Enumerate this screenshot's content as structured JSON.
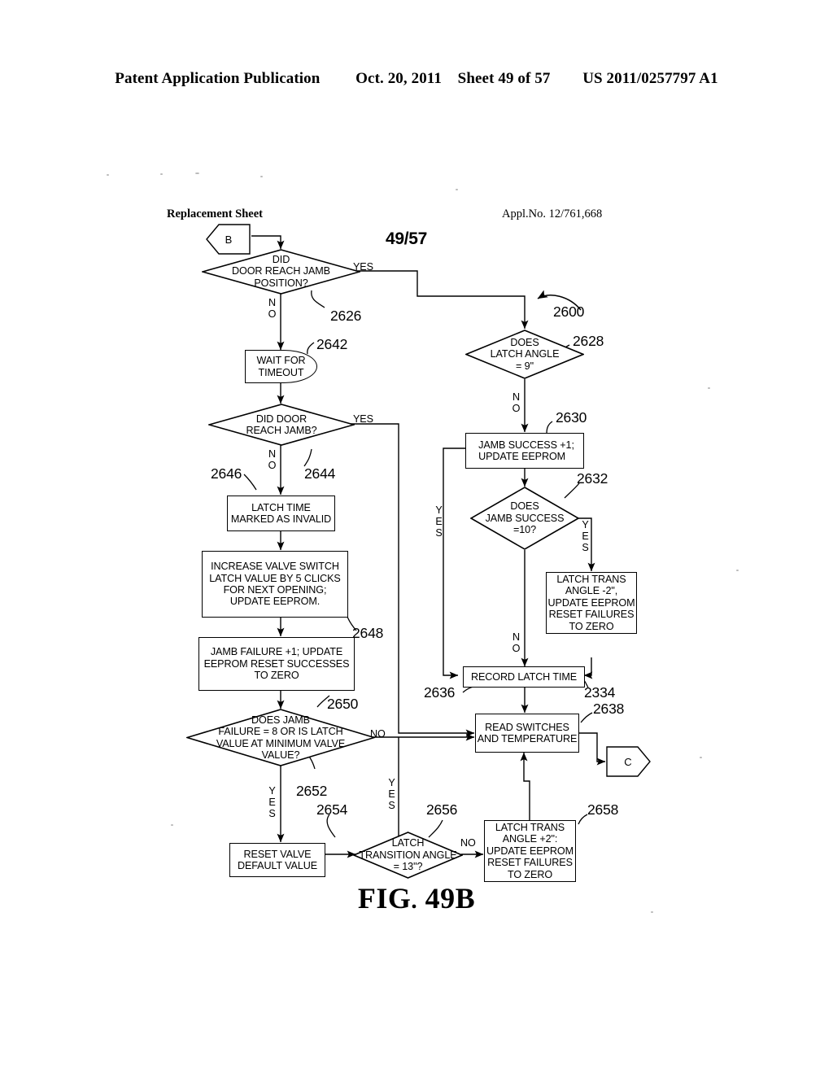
{
  "header": {
    "publication": "Patent Application Publication",
    "date": "Oct. 20, 2011",
    "sheet": "Sheet 49 of 57",
    "doc_number": "US 2011/0257797 A1"
  },
  "sheet_info": {
    "replacement_sheet": "Replacement Sheet",
    "appl_no": "Appl.No. 12/761,668",
    "sheet_fraction": "49/57"
  },
  "figure": {
    "caption_prefix": "FIG",
    "caption_dot": ".",
    "caption_number": "49B",
    "overall_ref": "2600"
  },
  "connectors": [
    {
      "id": "B",
      "label": "B",
      "direction": "left"
    },
    {
      "id": "C",
      "label": "C",
      "direction": "right"
    }
  ],
  "nodes": [
    {
      "id": "2626",
      "ref": "2626",
      "type": "decision",
      "text": "DID\nDOOR REACH JAMB\nPOSITION?"
    },
    {
      "id": "2642",
      "ref": "2642",
      "type": "wait",
      "text": "WAIT  FOR\nTIMEOUT"
    },
    {
      "id": "2644",
      "ref": "2644",
      "type": "decision",
      "text": "DID DOOR\nREACH JAMB?"
    },
    {
      "id": "2646",
      "ref": "2646",
      "type": "process",
      "text": "LATCH TIME\nMARKED AS INVALID"
    },
    {
      "id": "2648",
      "ref": "2648",
      "type": "process",
      "text": "INCREASE VALVE SWITCH\nLATCH VALUE BY 5 CLICKS\nFOR NEXT OPENING;\nUPDATE EEPROM."
    },
    {
      "id": "2650",
      "ref": "2650",
      "type": "process",
      "text": "JAMB FAILURE +1; UPDATE\nEEPROM RESET SUCCESSES\nTO ZERO"
    },
    {
      "id": "2652",
      "ref": "2652",
      "type": "decision",
      "text": "DOES JAMB\nFAILURE = 8 OR IS LATCH\nVALUE AT MINIMUM  VALVE\nVALUE?"
    },
    {
      "id": "2654",
      "ref": "2654",
      "type": "process",
      "text": "RESET VALVE\nDEFAULT VALUE"
    },
    {
      "id": "2656",
      "ref": "2656",
      "type": "decision",
      "text": "LATCH\nTRANSITION ANGLE\n= 13\"?"
    },
    {
      "id": "2658",
      "ref": "2658",
      "type": "process",
      "text": "LATCH TRANS\nANGLE +2\":\nUPDATE EEPROM\nRESET FAILURES\nTO ZERO"
    },
    {
      "id": "2628",
      "ref": "2628",
      "type": "decision",
      "text": "DOES\nLATCH ANGLE\n= 9\""
    },
    {
      "id": "2630",
      "ref": "2630",
      "type": "process",
      "text": "JAMB SUCCESS +1;\nUPDATE EEPROM"
    },
    {
      "id": "2632",
      "ref": "2632",
      "type": "decision",
      "text": "DOES\nJAMB SUCCESS\n=10?"
    },
    {
      "id": "2334",
      "ref": "2334",
      "type": "process",
      "text": "LATCH TRANS\nANGLE -2\",\nUPDATE EEPROM\nRESET FAILURES\nTO ZERO"
    },
    {
      "id": "2636",
      "ref": "2636",
      "type": "process",
      "text": "RECORD LATCH TIME"
    },
    {
      "id": "2638",
      "ref": "2638",
      "type": "process",
      "text": "READ SWITCHES\nAND TEMPERATURE"
    }
  ],
  "edge_labels": {
    "yes_2626": "YES",
    "no_2626": "N\nO",
    "yes_2644": "YES",
    "no_2644": "N\nO",
    "no_2652": "NO",
    "yes_2652": "Y\nE\nS",
    "yes_2654_branch": "Y\nE\nS",
    "no_2656": "NO",
    "no_2628": "N\nO",
    "yes_2630_loop": "Y\nE\nS",
    "yes_2632": "Y\nE\nS",
    "no_2632": "N\nO"
  }
}
